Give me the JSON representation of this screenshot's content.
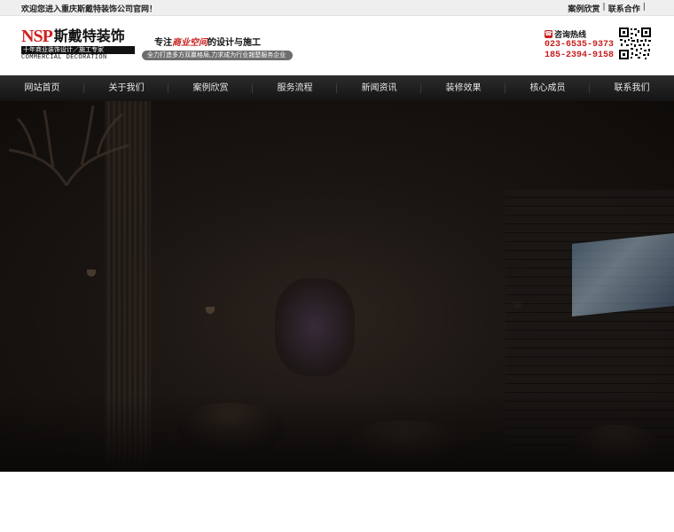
{
  "topbar": {
    "welcome": "欢迎您进入重庆斯戴特装饰公司官网！",
    "links": [
      "案例欣赏",
      "联系合作"
    ],
    "separator": "|"
  },
  "logo": {
    "brand_en": "NSP",
    "brand_cn": "斯戴特装饰",
    "tagline": "十年商业装饰设计／施工专家",
    "sub_en": "COMMERCIAL DECORATION"
  },
  "slogan": {
    "prefix": "专注",
    "highlight": "商业空间",
    "suffix": "的设计与施工",
    "sub": "全力打造多方双赢格局,力求成为行业翘楚服务企业"
  },
  "hotline": {
    "label": "咨询热线",
    "numbers": [
      "023-6535-9373",
      "185-2394-9158"
    ]
  },
  "nav": {
    "items": [
      "网站首页",
      "关于我们",
      "案例欣赏",
      "服务流程",
      "新闻资讯",
      "装修效果",
      "核心成员",
      "联系我们"
    ]
  },
  "colors": {
    "brand_red": "#c81e1e",
    "nav_bg": "#1c1c1c",
    "topbar_bg": "#efefef"
  },
  "icons": {
    "hotline": "phone-icon",
    "qr": "qr-code-icon"
  }
}
